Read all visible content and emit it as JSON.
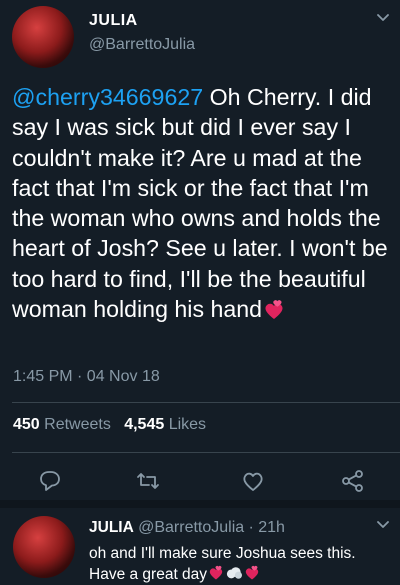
{
  "tweet": {
    "author_name": "JULIA",
    "author_handle": "@BarrettoJulia",
    "mention": "@cherry34669627",
    "body": " Oh Cherry. I did say I was sick but did I ever say I couldn't make it? Are u mad at the fact that I'm sick or the fact that I'm the woman who owns and holds the heart of Josh? See u later. I won't be too hard to find, I'll be the beautiful woman holding his hand",
    "timestamp": "1:45 PM · 04 Nov 18",
    "retweets_count": "450",
    "retweets_label": "Retweets",
    "likes_count": "4,545",
    "likes_label": "Likes"
  },
  "actions": [
    "reply-icon",
    "retweet-icon",
    "like-icon",
    "share-icon"
  ],
  "reply": {
    "author_name": "JULIA",
    "author_handle": "@BarrettoJulia",
    "time": "· 21h",
    "text": "oh and I'll make sure Joshua sees this. Have a great day"
  },
  "colors": {
    "background": "#141d26",
    "accent": "#1da1f2",
    "muted": "#8899a6",
    "heart": "#e0245e"
  }
}
